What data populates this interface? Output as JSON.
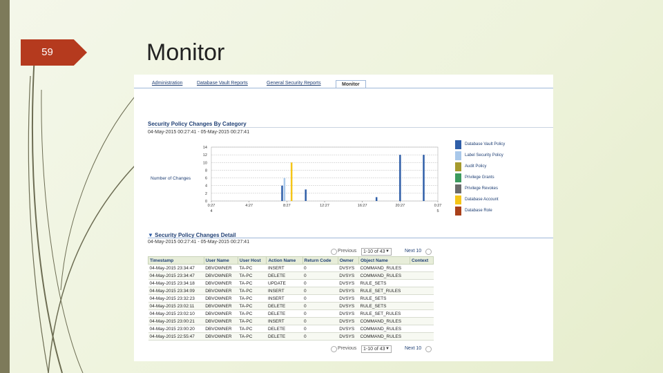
{
  "slide": {
    "number": "59",
    "title": "Monitor"
  },
  "screenshot": {
    "tabs": [
      {
        "label": "Administration"
      },
      {
        "label": "Database Vault Reports"
      },
      {
        "label": "General Security Reports"
      },
      {
        "label": "Monitor",
        "active": true
      }
    ],
    "chart_section": {
      "title": "Security Policy Changes By Category",
      "range": "04-May-2015 00:27:41 - 05-May-2015 00:27:41"
    },
    "detail_section": {
      "title": "Security Policy Changes Detail",
      "range": "04-May-2015 00:27:41 - 05-May-2015 00:27:41",
      "pager": {
        "previous_label": "Previous",
        "range_label": "1-10 of 43",
        "next_label": "Next 10"
      },
      "columns": [
        "Timestamp",
        "User Name",
        "User Host",
        "Action Name",
        "Return Code",
        "Owner",
        "Object Name",
        "Context"
      ],
      "rows": [
        [
          "04-May-2015 23:34:47",
          "DBVOWNER",
          "TA-PC",
          "INSERT",
          "0",
          "DVSYS",
          "COMMAND_RULES",
          ""
        ],
        [
          "04-May-2015 23:34:47",
          "DBVOWNER",
          "TA-PC",
          "DELETE",
          "0",
          "DVSYS",
          "COMMAND_RULES",
          ""
        ],
        [
          "04-May-2015 23:34:18",
          "DBVOWNER",
          "TA-PC",
          "UPDATE",
          "0",
          "DVSYS",
          "RULE_SETS",
          ""
        ],
        [
          "04-May-2015 23:34:09",
          "DBVOWNER",
          "TA-PC",
          "INSERT",
          "0",
          "DVSYS",
          "RULE_SET_RULES",
          ""
        ],
        [
          "04-May-2015 23:32:23",
          "DBVOWNER",
          "TA-PC",
          "INSERT",
          "0",
          "DVSYS",
          "RULE_SETS",
          ""
        ],
        [
          "04-May-2015 23:02:11",
          "DBVOWNER",
          "TA-PC",
          "DELETE",
          "0",
          "DVSYS",
          "RULE_SETS",
          ""
        ],
        [
          "04-May-2015 23:02:10",
          "DBVOWNER",
          "TA-PC",
          "DELETE",
          "0",
          "DVSYS",
          "RULE_SET_RULES",
          ""
        ],
        [
          "04-May-2015 23:00:21",
          "DBVOWNER",
          "TA-PC",
          "INSERT",
          "0",
          "DVSYS",
          "COMMAND_RULES",
          ""
        ],
        [
          "04-May-2015 23:00:20",
          "DBVOWNER",
          "TA-PC",
          "DELETE",
          "0",
          "DVSYS",
          "COMMAND_RULES",
          ""
        ],
        [
          "04-May-2015 22:55:47",
          "DBVOWNER",
          "TA-PC",
          "DELETE",
          "0",
          "DVSYS",
          "COMMAND_RULES",
          ""
        ]
      ]
    }
  },
  "chart_data": {
    "type": "bar",
    "ylabel": "Number of Changes",
    "y_ticks": [
      "14",
      "12",
      "10",
      "8",
      "6",
      "4",
      "2",
      "0"
    ],
    "ylim": [
      0,
      14
    ],
    "x_tick_labels": [
      "0:27",
      "4:27",
      "8:27",
      "12:27",
      "16:27",
      "20:27",
      "0:27"
    ],
    "x_sub_labels": [
      {
        "tick": 0,
        "text": "4"
      },
      {
        "tick": 6,
        "text": "5"
      }
    ],
    "hour_span": 24,
    "series": [
      {
        "name": "Database Vault Policy",
        "color": "#2f5ea8"
      },
      {
        "name": "Label Security Policy",
        "color": "#a9c8ea"
      },
      {
        "name": "Audit Policy",
        "color": "#a59a2e"
      },
      {
        "name": "Privilege Grants",
        "color": "#3c9a5e"
      },
      {
        "name": "Privilege Revokes",
        "color": "#6b6b6b"
      },
      {
        "name": "Database Account",
        "color": "#f5c518"
      },
      {
        "name": "Database Role",
        "color": "#a9401a"
      }
    ],
    "bars": [
      {
        "hour": 7.5,
        "series": 0,
        "value": 4
      },
      {
        "hour": 7.75,
        "series": 1,
        "value": 6
      },
      {
        "hour": 8.5,
        "series": 5,
        "value": 10
      },
      {
        "hour": 10.0,
        "series": 0,
        "value": 3
      },
      {
        "hour": 17.5,
        "series": 0,
        "value": 1
      },
      {
        "hour": 20.0,
        "series": 0,
        "value": 12
      },
      {
        "hour": 22.5,
        "series": 0,
        "value": 12
      }
    ]
  }
}
